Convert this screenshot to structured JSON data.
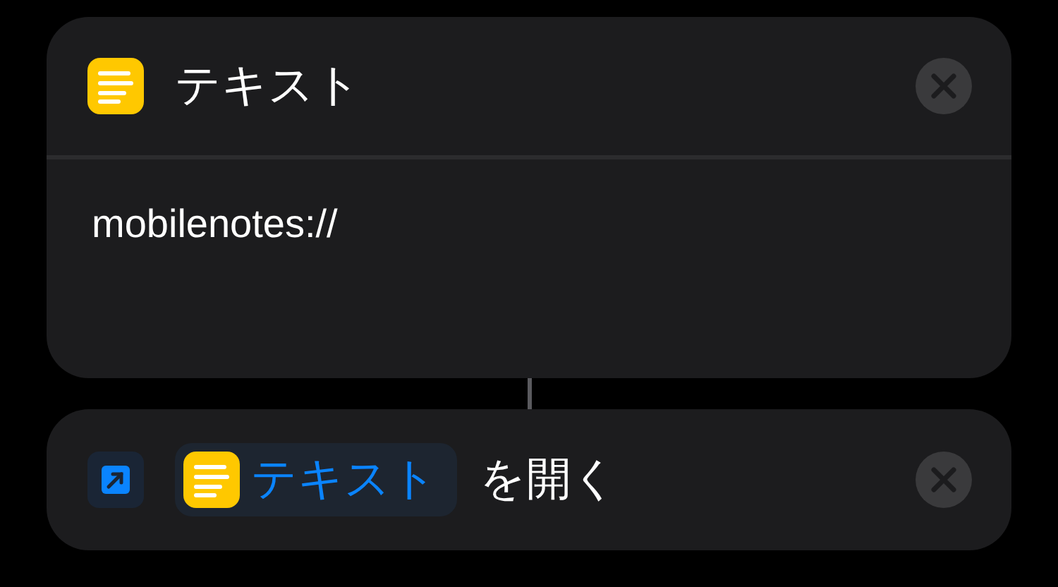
{
  "text_action": {
    "title": "テキスト",
    "content": "mobilenotes://"
  },
  "open_action": {
    "variable": "テキスト",
    "label": "を開く"
  }
}
